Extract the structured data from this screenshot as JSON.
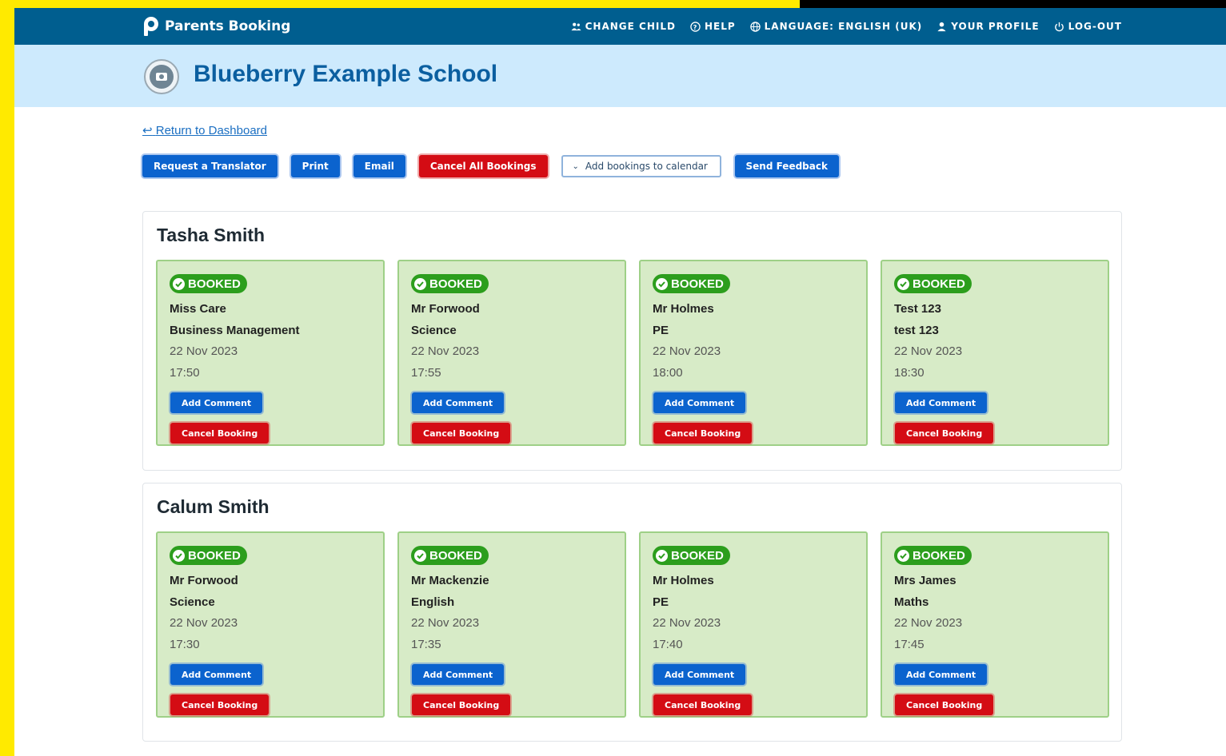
{
  "topbar": {
    "brand": "Parents Booking",
    "nav": [
      {
        "label": "CHANGE CHILD",
        "icon": "users-icon"
      },
      {
        "label": "HELP",
        "icon": "help-icon"
      },
      {
        "label": "LANGUAGE: ENGLISH (UK)",
        "icon": "globe-icon"
      },
      {
        "label": "YOUR PROFILE",
        "icon": "user-icon"
      },
      {
        "label": "LOG-OUT",
        "icon": "power-icon"
      }
    ]
  },
  "banner": {
    "school_name": "Blueberry Example School"
  },
  "return_link": "Return to Dashboard",
  "toolbar": {
    "translator": "Request a Translator",
    "print": "Print",
    "email": "Email",
    "cancel_all": "Cancel All Bookings",
    "calendar": "Add bookings to calendar",
    "feedback": "Send Feedback"
  },
  "colors": {
    "topbar": "#005e8f",
    "banner": "#cdeafd",
    "booked_card": "#d7ebc7",
    "booked_badge": "#2c9e1d",
    "primary_button": "#0b63ce",
    "danger_button": "#d40c14"
  },
  "children": [
    {
      "name": "Tasha Smith",
      "bookings": [
        {
          "status": "BOOKED",
          "teacher": "Miss Care",
          "subject": "Business Management",
          "date": "22 Nov 2023",
          "time": "17:50",
          "add_comment": "Add Comment",
          "cancel": "Cancel Booking"
        },
        {
          "status": "BOOKED",
          "teacher": "Mr Forwood",
          "subject": "Science",
          "date": "22 Nov 2023",
          "time": "17:55",
          "add_comment": "Add Comment",
          "cancel": "Cancel Booking"
        },
        {
          "status": "BOOKED",
          "teacher": "Mr Holmes",
          "subject": "PE",
          "date": "22 Nov 2023",
          "time": "18:00",
          "add_comment": "Add Comment",
          "cancel": "Cancel Booking"
        },
        {
          "status": "BOOKED",
          "teacher": "Test 123",
          "subject": "test 123",
          "date": "22 Nov 2023",
          "time": "18:30",
          "add_comment": "Add Comment",
          "cancel": "Cancel Booking"
        }
      ]
    },
    {
      "name": "Calum Smith",
      "bookings": [
        {
          "status": "BOOKED",
          "teacher": "Mr Forwood",
          "subject": "Science",
          "date": "22 Nov 2023",
          "time": "17:30",
          "add_comment": "Add Comment",
          "cancel": "Cancel Booking"
        },
        {
          "status": "BOOKED",
          "teacher": "Mr Mackenzie",
          "subject": "English",
          "date": "22 Nov 2023",
          "time": "17:35",
          "add_comment": "Add Comment",
          "cancel": "Cancel Booking"
        },
        {
          "status": "BOOKED",
          "teacher": "Mr Holmes",
          "subject": "PE",
          "date": "22 Nov 2023",
          "time": "17:40",
          "add_comment": "Add Comment",
          "cancel": "Cancel Booking"
        },
        {
          "status": "BOOKED",
          "teacher": "Mrs James",
          "subject": "Maths",
          "date": "22 Nov 2023",
          "time": "17:45",
          "add_comment": "Add Comment",
          "cancel": "Cancel Booking"
        }
      ]
    }
  ]
}
